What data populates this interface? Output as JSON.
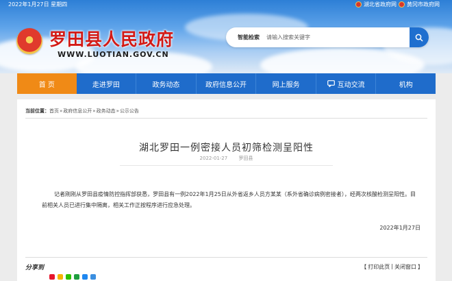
{
  "topbar": {
    "date": "2022年1月27日 星期四",
    "links": [
      "湖北省政府网",
      "黄冈市政府网"
    ]
  },
  "header": {
    "title": "罗田县人民政府",
    "domain": "WWW.LUOTIAN.GOV.CN"
  },
  "search": {
    "label": "智能检索",
    "placeholder": "请输入搜索关键字"
  },
  "nav": {
    "items": [
      "首 页",
      "走进罗田",
      "政务动态",
      "政府信息公开",
      "网上服务",
      "互动交流",
      "机构"
    ],
    "active_color": "#f08a16",
    "bar_color": "#1f6ccb"
  },
  "breadcrumb": {
    "prefix": "当前位置：",
    "items": [
      "首页",
      "政府信息公开",
      "政务动态",
      "公示公告"
    ],
    "separator": "»"
  },
  "article": {
    "title": "湖北罗田一例密接人员初筛检测呈阳性",
    "date": "2022-01-27",
    "source": "罗田县",
    "body": "记者刚刚从罗田县疫情防控指挥部获悉，罗田县有一例2022年1月25日从外省返乡人员方某某（系外省确诊病例密接者），经两次核酸检测呈阳性。目前相关人员已进行集中隔离，相关工作正按程序进行应急处理。",
    "signed_date": "2022年1月27日"
  },
  "footer": {
    "share_label": "分享到",
    "share_icons": [
      "weibo-icon",
      "qzone-icon",
      "wechat-icon",
      "douban-icon",
      "qq-icon",
      "more-icon"
    ],
    "print": "打印此页",
    "close": "关闭窗口",
    "bracket_open": "【",
    "bracket_close": "】",
    "pipe": "|"
  }
}
